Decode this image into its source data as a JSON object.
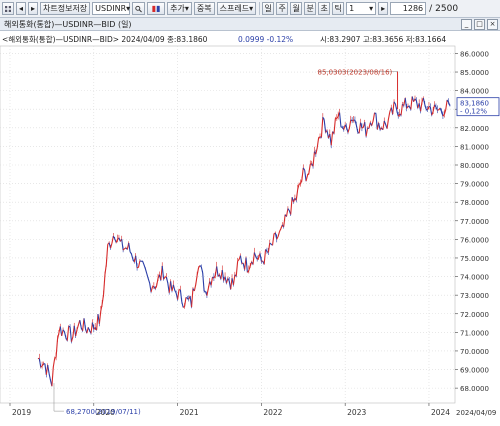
{
  "toolbar": {
    "grid_icon": "grid-icon",
    "nav_left": "◂",
    "nav_right": "▸",
    "save_chart": "차트정보저장",
    "symbol": "USDINR",
    "add": "추가",
    "overlay": "중복",
    "spread": "스프레드",
    "periods": [
      "일",
      "주",
      "월",
      "분",
      "초",
      "틱"
    ],
    "period_count": "1",
    "count": "1286",
    "total": "2500"
  },
  "window": {
    "title": "해외통화(통합)—USDINR—BID (일)"
  },
  "chart_header": "<해외통화(통합)—USDINR—BID> 2024/04/09 종:83.1860",
  "chart_header_change": "0.0999  -0.12%",
  "chart_header_ohl": "시:83.2907 고:83.3656 저:83.1664",
  "colors": {
    "up": "#d62a2a",
    "down": "#2b3fa8",
    "axis": "#444444",
    "grid": "#d9d9d9"
  },
  "chart_data": {
    "type": "line",
    "series": [
      {
        "x": [
          "2019-05",
          "2019-06",
          "2019-07",
          "2019-08",
          "2019-09",
          "2019-10",
          "2019-11",
          "2019-12",
          "2020-01",
          "2020-02",
          "2020-03",
          "2020-04",
          "2020-05",
          "2020-06",
          "2020-07",
          "2020-08",
          "2020-09",
          "2020-10",
          "2020-11",
          "2020-12",
          "2021-01",
          "2021-02",
          "2021-03",
          "2021-04",
          "2021-05",
          "2021-06",
          "2021-07",
          "2021-08",
          "2021-09",
          "2021-10",
          "2021-11",
          "2021-12",
          "2022-01",
          "2022-02",
          "2022-03",
          "2022-04",
          "2022-05",
          "2022-06",
          "2022-07",
          "2022-08",
          "2022-09",
          "2022-10",
          "2022-11",
          "2022-12",
          "2023-01",
          "2023-02",
          "2023-03",
          "2023-04",
          "2023-05",
          "2023-06",
          "2023-07",
          "2023-08",
          "2023-09",
          "2023-10",
          "2023-11",
          "2023-12",
          "2024-01",
          "2024-02",
          "2024-03",
          "2024-04"
        ],
        "values": [
          69.6,
          69.3,
          68.3,
          71.2,
          71.0,
          70.8,
          71.5,
          71.2,
          71.3,
          71.8,
          75.5,
          76.4,
          75.6,
          75.5,
          74.9,
          74.4,
          73.6,
          73.6,
          74.3,
          73.3,
          73.1,
          72.7,
          72.6,
          74.9,
          73.2,
          74.1,
          74.4,
          74.0,
          73.6,
          75.0,
          74.6,
          75.2,
          74.8,
          75.3,
          76.0,
          76.4,
          77.6,
          78.2,
          79.5,
          79.6,
          81.2,
          82.4,
          81.3,
          82.7,
          81.8,
          82.6,
          82.1,
          81.9,
          82.7,
          82.1,
          82.2,
          83.0,
          83.0,
          83.3,
          83.3,
          83.2,
          83.1,
          82.9,
          83.0,
          83.19
        ]
      }
    ],
    "ylim": [
      67.2,
      86.4
    ],
    "y_ticks": [
      "86.0000",
      "85.0000",
      "84.0000",
      "83.0000",
      "82.0000",
      "81.0000",
      "80.0000",
      "79.0000",
      "78.0000",
      "77.0000",
      "76.0000",
      "75.0000",
      "74.0000",
      "73.0000",
      "72.0000",
      "71.0000",
      "70.0000",
      "69.0000",
      "68.0000"
    ],
    "x_ticks": [
      "2019",
      "2020",
      "2021",
      "2022",
      "2023",
      "2024",
      "2024/04/09"
    ],
    "annotations": {
      "high": "85,0303(2023/08/16)",
      "low": "68,2700(2019/07/11)"
    },
    "last_label": "83,1860",
    "last_change_label": "- 0,12%",
    "grid": true
  }
}
